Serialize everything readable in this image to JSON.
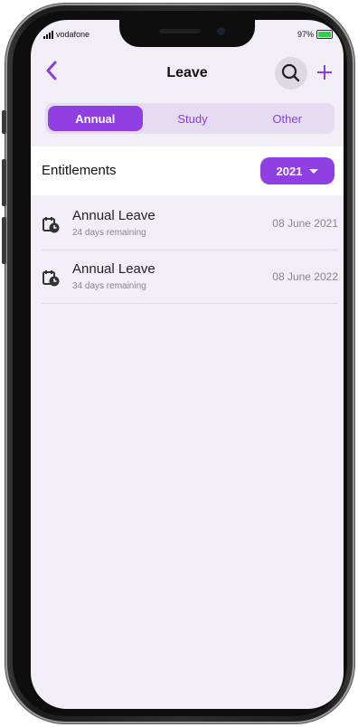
{
  "status": {
    "carrier": "vodafone",
    "battery": "97%",
    "battery_level": 0.97
  },
  "header": {
    "title": "Leave",
    "back_icon": "chevron-left-icon",
    "search_icon": "search-icon",
    "add_icon": "plus-icon"
  },
  "tabs": [
    {
      "label": "Annual",
      "active": true
    },
    {
      "label": "Study",
      "active": false
    },
    {
      "label": "Other",
      "active": false
    }
  ],
  "entitlements": {
    "title": "Entitlements",
    "year": "2021"
  },
  "items": [
    {
      "name": "Annual Leave",
      "remaining": "24 days remaining",
      "date": "08 June 2021"
    },
    {
      "name": "Annual Leave",
      "remaining": "34 days remaining",
      "date": "08 June 2022"
    }
  ],
  "colors": {
    "accent": "#8f3fe2",
    "tab_bg": "#e5dcf4",
    "screen_bg": "#f1eef7"
  }
}
